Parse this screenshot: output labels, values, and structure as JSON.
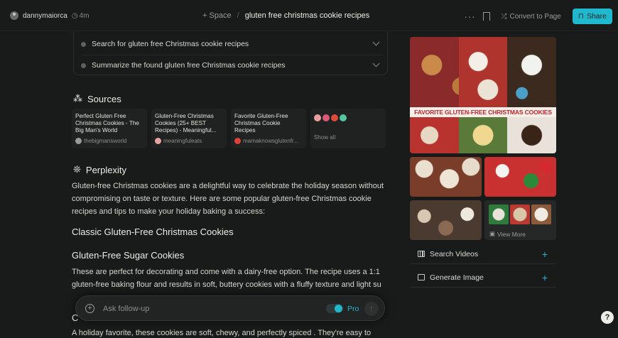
{
  "header": {
    "username": "dannymaiorca",
    "elapsed": "4m",
    "space_label": "+ Space",
    "separator": "/",
    "thread_title": "gluten free christmas cookie recipes",
    "more_label": "···",
    "convert_label": "Convert to Page",
    "share_label": "Share"
  },
  "steps": [
    {
      "label": "Search for gluten free Christmas cookie recipes"
    },
    {
      "label": "Summarize the found gluten free Christmas cookie recipes"
    }
  ],
  "sources": {
    "heading": "Sources",
    "cards": [
      {
        "title": "Perfect Gluten Free Christmas Cookies - The Big Man's World",
        "site": "thebigmansworld",
        "favicon_color": "#9a9a98"
      },
      {
        "title": "Gluten-Free Christmas Cookies (25+ BEST Recipes) - Meaningful...",
        "site": "meaningfuleats",
        "favicon_color": "#e6a4a4"
      },
      {
        "title": "Favorite Gluten-Free Christmas Cookie Recipes",
        "site": "mamaknowsglutenfr...",
        "favicon_color": "#d9433a"
      }
    ],
    "show_all_label": "Show all",
    "more_favicon_colors": [
      "#e8a0a0",
      "#d8597a",
      "#e04a3a",
      "#56c4a0"
    ]
  },
  "answer": {
    "heading": "Perplexity",
    "intro": "Gluten-free Christmas cookies are a delightful way to celebrate the holiday season without compromising on taste or texture. Here are some popular gluten-free Christmas cookie recipes and tips to make your holiday baking a success:",
    "section_title": "Classic Gluten-Free Christmas Cookies",
    "sub_title": "Gluten-Free Sugar Cookies",
    "sugar_text": "These are perfect for decorating and come with a dairy-free option. The recipe uses a 1:1 gluten-free baking flour and results in soft, buttery cookies with a fluffy texture and light su",
    "next_heading_fragment": "C",
    "next_text": "A holiday favorite, these cookies are soft, chewy, and perfectly spiced . They're easy to"
  },
  "followup": {
    "placeholder": "Ask follow-up",
    "pro_label": "Pro"
  },
  "media": {
    "banner_text": "FAVORITE GLUTEN-FREE CHRISTMAS COOKIES",
    "view_more_label": "View More",
    "search_videos_label": "Search Videos",
    "generate_image_label": "Generate Image"
  },
  "help_label": "?",
  "colors": {
    "background": "#191a1a",
    "accent": "#20b8cd",
    "card": "#202222"
  }
}
